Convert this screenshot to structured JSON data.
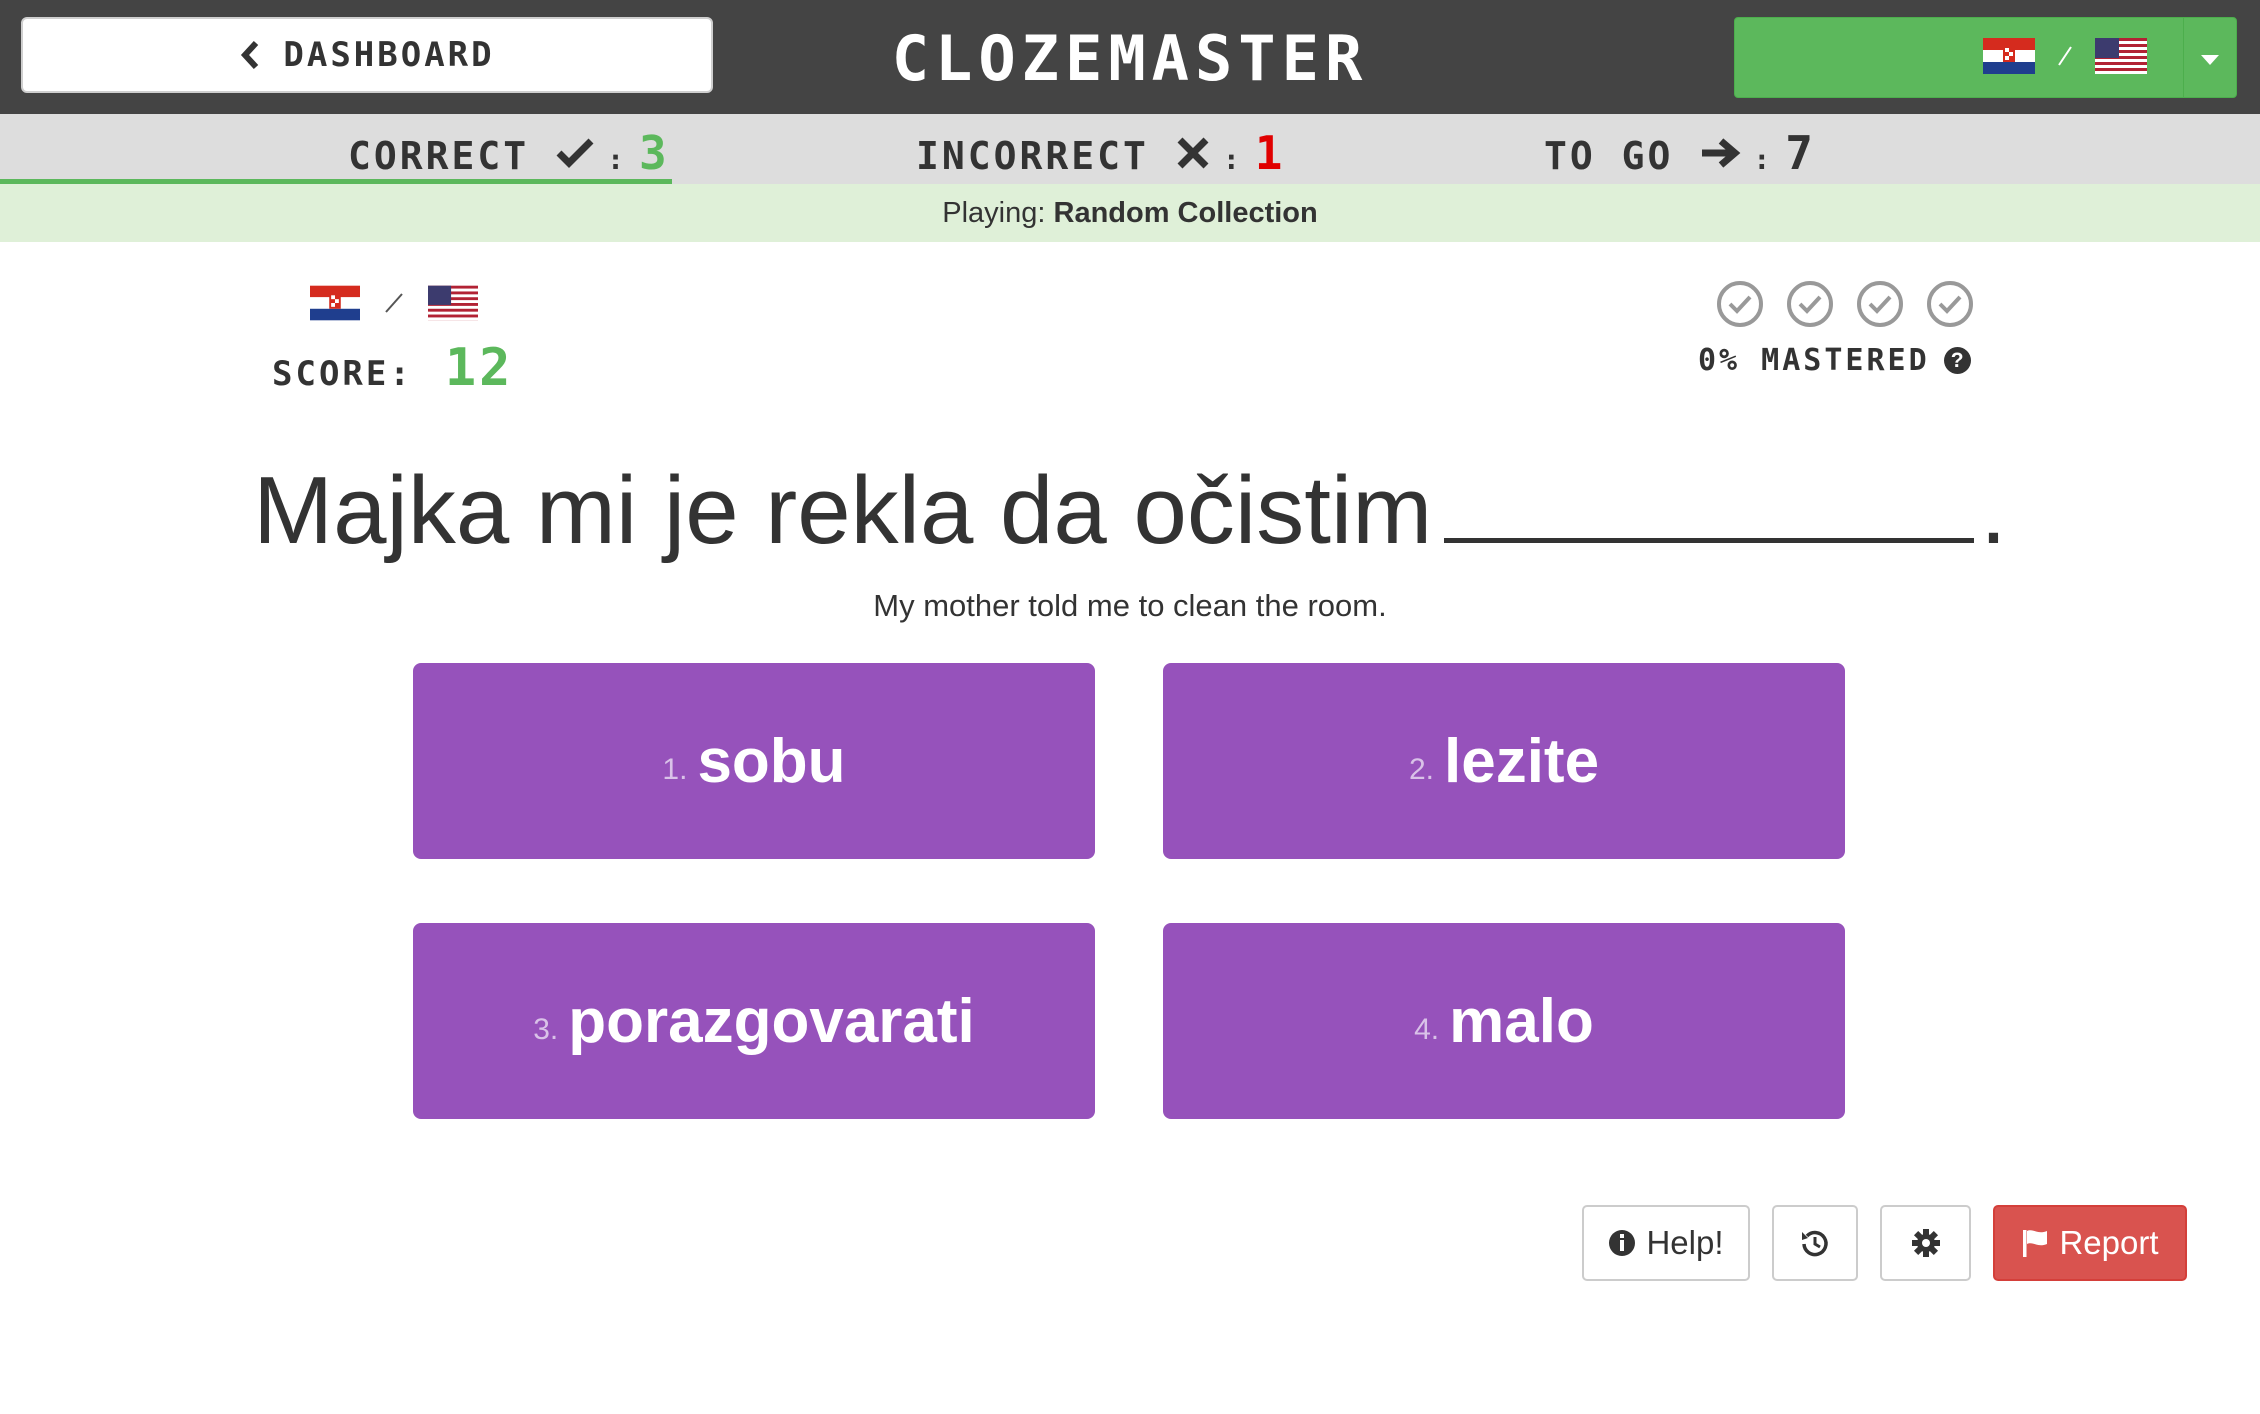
{
  "navbar": {
    "back_label": "DASHBOARD",
    "brand": "CLOZEMASTER",
    "language_pair": {
      "from_flag": "croatia-flag",
      "to_flag": "us-flag"
    }
  },
  "stats": {
    "correct_label": "CORRECT",
    "correct_value": "3",
    "incorrect_label": "INCORRECT",
    "incorrect_value": "1",
    "togo_label": "TO GO",
    "togo_value": "7"
  },
  "playing": {
    "prefix": "Playing:",
    "collection": "Random Collection"
  },
  "score": {
    "label": "SCORE:",
    "value": "12"
  },
  "mastery": {
    "label": "0% MASTERED",
    "checks": 4
  },
  "question": {
    "sentence": "Majka mi je rekla da očistim",
    "end": ".",
    "translation": "My mother told me to clean the room."
  },
  "choices": [
    {
      "num": "1.",
      "word": "sobu"
    },
    {
      "num": "2.",
      "word": "lezite"
    },
    {
      "num": "3.",
      "word": "porazgovarati"
    },
    {
      "num": "4.",
      "word": "malo"
    }
  ],
  "footer": {
    "help_label": "Help!",
    "report_label": "Report"
  },
  "colors": {
    "navbar": "#444444",
    "accent_green": "#5cb85c",
    "incorrect_red": "#e00000",
    "choice_purple": "#9652bb",
    "report_red": "#d9534f"
  }
}
